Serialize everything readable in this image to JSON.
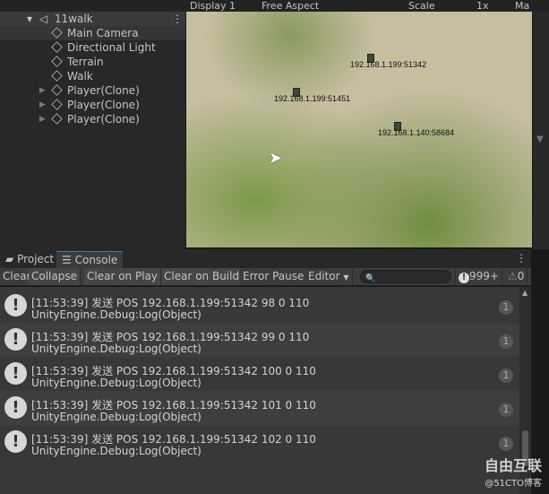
{
  "topbar": {
    "display": "Display 1",
    "aspect": "Free Aspect",
    "scale": "Scale",
    "scale_value": "1x",
    "maximize": "Ma"
  },
  "hierarchy": {
    "scene": "11walk",
    "items": [
      {
        "label": "Main Camera",
        "expandable": false
      },
      {
        "label": "Directional Light",
        "expandable": false
      },
      {
        "label": "Terrain",
        "expandable": false
      },
      {
        "label": "Walk",
        "expandable": false
      },
      {
        "label": "Player(Clone)",
        "expandable": true
      },
      {
        "label": "Player(Clone)",
        "expandable": true
      },
      {
        "label": "Player(Clone)",
        "expandable": true
      }
    ]
  },
  "game": {
    "labels": [
      "192.168.1.199:51342",
      "192.168.1.199:51451",
      "192.168.1.140:58684"
    ]
  },
  "tabs": [
    {
      "label": "Project",
      "icon": "folder-icon"
    },
    {
      "label": "Console",
      "icon": "console-icon",
      "active": true
    }
  ],
  "toolbar": {
    "clear": "Clear",
    "collapse": "Collapse",
    "clear_on_play": "Clear on Play",
    "clear_on_build": "Clear on Build",
    "error_pause": "Error Pause",
    "editor": "Editor",
    "log_count": "999+",
    "warn_count": "0"
  },
  "logs": [
    {
      "message": "[11:53:39] 发送 POS 192.168.1.199:51342 98 0 110",
      "trace": "UnityEngine.Debug:Log(Object)",
      "count": "1"
    },
    {
      "message": "[11:53:39] 发送 POS 192.168.1.199:51342 99 0 110",
      "trace": "UnityEngine.Debug:Log(Object)",
      "count": "1"
    },
    {
      "message": "[11:53:39] 发送 POS 192.168.1.199:51342 100 0 110",
      "trace": "UnityEngine.Debug:Log(Object)",
      "count": "1"
    },
    {
      "message": "[11:53:39] 发送 POS 192.168.1.199:51342 101 0 110",
      "trace": "UnityEngine.Debug:Log(Object)",
      "count": "1"
    },
    {
      "message": "[11:53:39] 发送 POS 192.168.1.199:51342 102 0 110",
      "trace": "UnityEngine.Debug:Log(Object)",
      "count": "1"
    }
  ],
  "watermark": {
    "brand": "自由互联",
    "sub": "@51CTO博客"
  }
}
